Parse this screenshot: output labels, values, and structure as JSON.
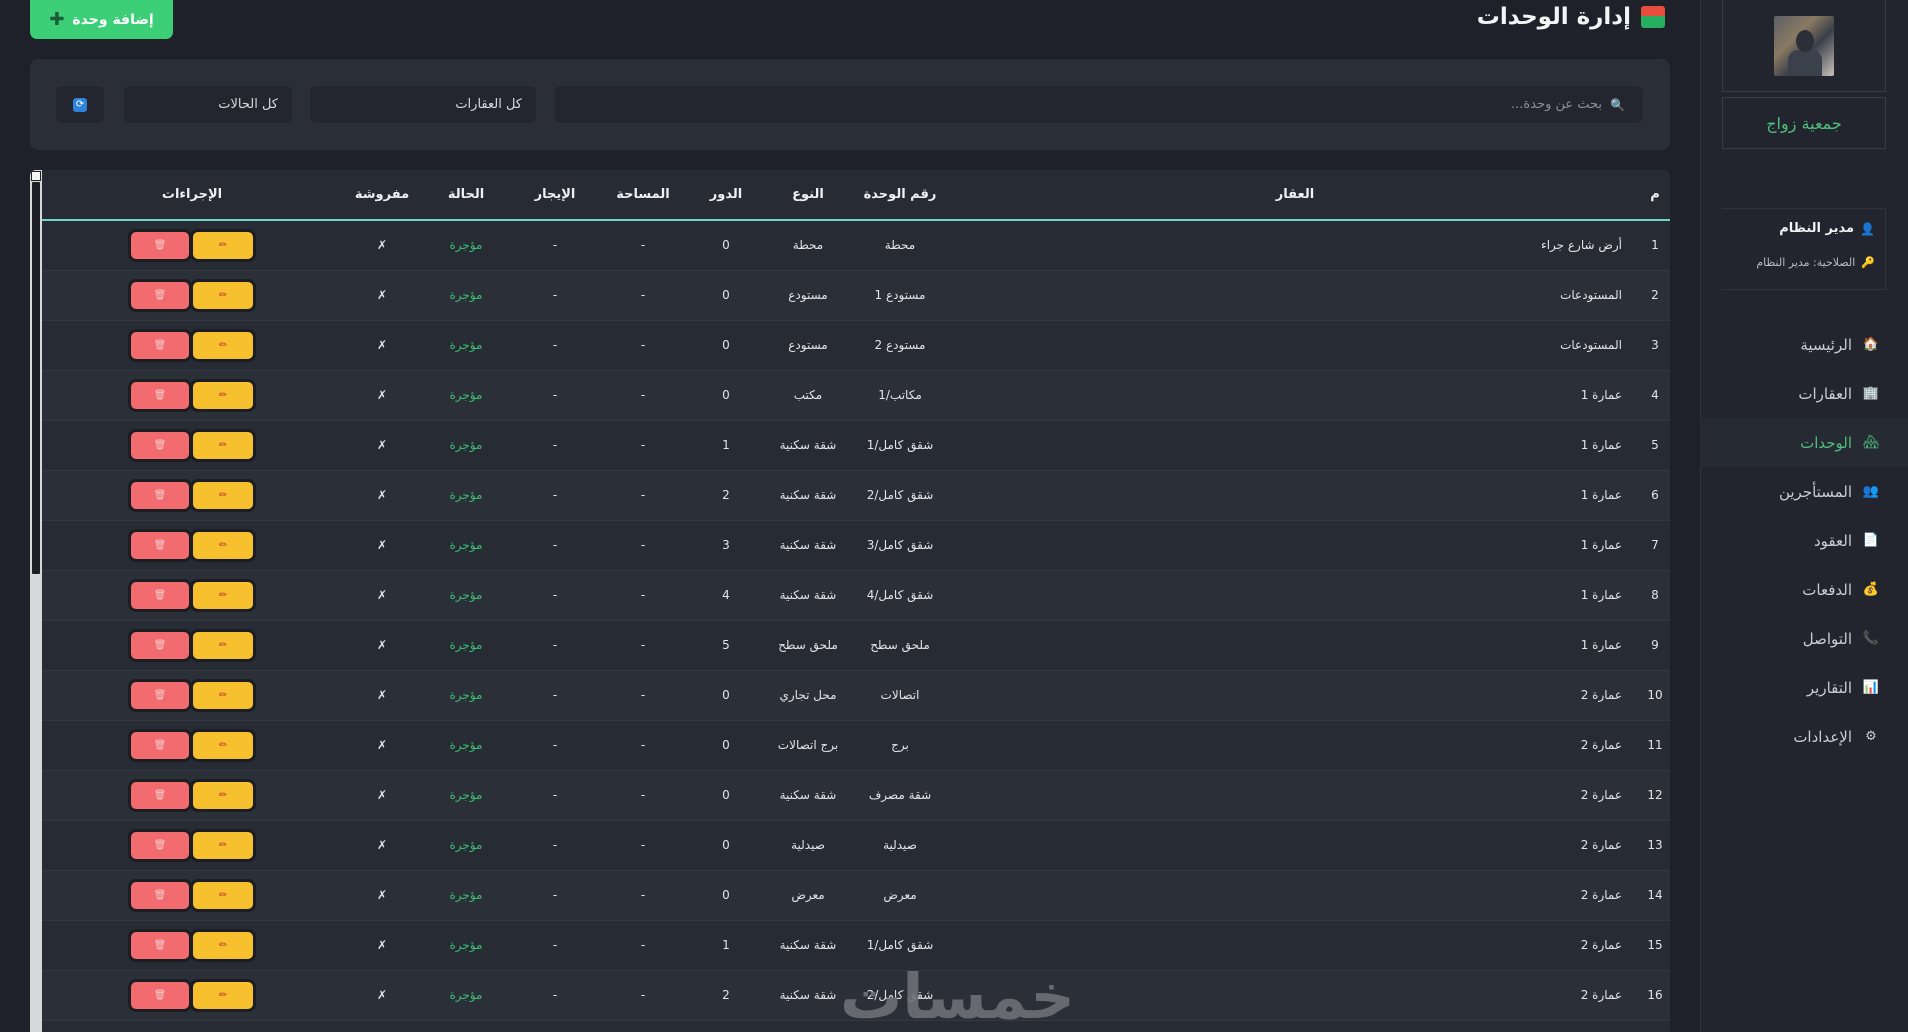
{
  "page": {
    "title": "إدارة الوحدات",
    "title_icon": "house-icon",
    "add_button": "إضافة وحدة",
    "add_icon": "plus-icon"
  },
  "filters": {
    "search_placeholder": "بحث عن وحدة...",
    "properties_select": "كل العقارات",
    "status_select": "كل الحالات",
    "refresh_icon": "refresh-icon"
  },
  "sidebar": {
    "brand": "جمعية زواج",
    "user_name": "مدير النظام",
    "user_role": "الصلاحية: مدير النظام",
    "nav": [
      {
        "label": "الرئيسية",
        "icon": "🏠",
        "icon_name": "home-icon"
      },
      {
        "label": "العقارات",
        "icon": "🏢",
        "icon_name": "building-icon"
      },
      {
        "label": "الوحدات",
        "icon": "🏘",
        "icon_name": "units-icon",
        "active": true
      },
      {
        "label": "المستأجرين",
        "icon": "👥",
        "icon_name": "people-icon"
      },
      {
        "label": "العقود",
        "icon": "📄",
        "icon_name": "document-icon"
      },
      {
        "label": "الدفعات",
        "icon": "💰",
        "icon_name": "money-bag-icon"
      },
      {
        "label": "التواصل",
        "icon": "📞",
        "icon_name": "phone-icon"
      },
      {
        "label": "التقارير",
        "icon": "📊",
        "icon_name": "chart-icon"
      },
      {
        "label": "الإعدادات",
        "icon": "⚙",
        "icon_name": "gear-icon"
      }
    ]
  },
  "table": {
    "headers": [
      "م",
      "العقار",
      "رقم الوحدة",
      "النوع",
      "الدور",
      "المساحة",
      "الإيجار",
      "الحالة",
      "مفروشة",
      "الإجراءات"
    ],
    "rows": [
      {
        "n": "1",
        "property": "أرض شارع جراء",
        "unit": "محطة",
        "type": "محطة",
        "floor": "0",
        "area": "-",
        "rent": "-",
        "status": "مؤجرة",
        "furnished": "✗"
      },
      {
        "n": "2",
        "property": "المستودعات",
        "unit": "مستودع 1",
        "type": "مستودع",
        "floor": "0",
        "area": "-",
        "rent": "-",
        "status": "مؤجرة",
        "furnished": "✗"
      },
      {
        "n": "3",
        "property": "المستودعات",
        "unit": "مستودع 2",
        "type": "مستودع",
        "floor": "0",
        "area": "-",
        "rent": "-",
        "status": "مؤجرة",
        "furnished": "✗"
      },
      {
        "n": "4",
        "property": "عمارة 1",
        "unit": "مكاتب/1",
        "type": "مكتب",
        "floor": "0",
        "area": "-",
        "rent": "-",
        "status": "مؤجرة",
        "furnished": "✗"
      },
      {
        "n": "5",
        "property": "عمارة 1",
        "unit": "شقق كامل/1",
        "type": "شقة سكنية",
        "floor": "1",
        "area": "-",
        "rent": "-",
        "status": "مؤجرة",
        "furnished": "✗"
      },
      {
        "n": "6",
        "property": "عمارة 1",
        "unit": "شقق كامل/2",
        "type": "شقة سكنية",
        "floor": "2",
        "area": "-",
        "rent": "-",
        "status": "مؤجرة",
        "furnished": "✗"
      },
      {
        "n": "7",
        "property": "عمارة 1",
        "unit": "شقق كامل/3",
        "type": "شقة سكنية",
        "floor": "3",
        "area": "-",
        "rent": "-",
        "status": "مؤجرة",
        "furnished": "✗"
      },
      {
        "n": "8",
        "property": "عمارة 1",
        "unit": "شقق كامل/4",
        "type": "شقة سكنية",
        "floor": "4",
        "area": "-",
        "rent": "-",
        "status": "مؤجرة",
        "furnished": "✗"
      },
      {
        "n": "9",
        "property": "عمارة 1",
        "unit": "ملحق سطح",
        "type": "ملحق سطح",
        "floor": "5",
        "area": "-",
        "rent": "-",
        "status": "مؤجرة",
        "furnished": "✗"
      },
      {
        "n": "10",
        "property": "عمارة 2",
        "unit": "اتصالات",
        "type": "محل تجاري",
        "floor": "0",
        "area": "-",
        "rent": "-",
        "status": "مؤجرة",
        "furnished": "✗"
      },
      {
        "n": "11",
        "property": "عمارة 2",
        "unit": "برج",
        "type": "برج اتصالات",
        "floor": "0",
        "area": "-",
        "rent": "-",
        "status": "مؤجرة",
        "furnished": "✗"
      },
      {
        "n": "12",
        "property": "عمارة 2",
        "unit": "شقة مصرف",
        "type": "شقة سكنية",
        "floor": "0",
        "area": "-",
        "rent": "-",
        "status": "مؤجرة",
        "furnished": "✗"
      },
      {
        "n": "13",
        "property": "عمارة 2",
        "unit": "صيدلية",
        "type": "صيدلية",
        "floor": "0",
        "area": "-",
        "rent": "-",
        "status": "مؤجرة",
        "furnished": "✗"
      },
      {
        "n": "14",
        "property": "عمارة 2",
        "unit": "معرض",
        "type": "معرض",
        "floor": "0",
        "area": "-",
        "rent": "-",
        "status": "مؤجرة",
        "furnished": "✗"
      },
      {
        "n": "15",
        "property": "عمارة 2",
        "unit": "شقق كامل/1",
        "type": "شقة سكنية",
        "floor": "1",
        "area": "-",
        "rent": "-",
        "status": "مؤجرة",
        "furnished": "✗"
      },
      {
        "n": "16",
        "property": "عمارة 2",
        "unit": "شقق كامل/2",
        "type": "شقة سكنية",
        "floor": "2",
        "area": "-",
        "rent": "-",
        "status": "مؤجرة",
        "furnished": "✗"
      }
    ],
    "edit_icon": "pencil-icon",
    "delete_icon": "trash-icon"
  },
  "watermark": "خمسات",
  "colors": {
    "background": "#1e2129",
    "panel": "#2a2e37",
    "accent_green": "#3ccf78",
    "status_green": "#3dbd72",
    "edit_yellow": "#f7c02f",
    "delete_red": "#f16b6f",
    "header_underline": "#6fd3c6"
  }
}
